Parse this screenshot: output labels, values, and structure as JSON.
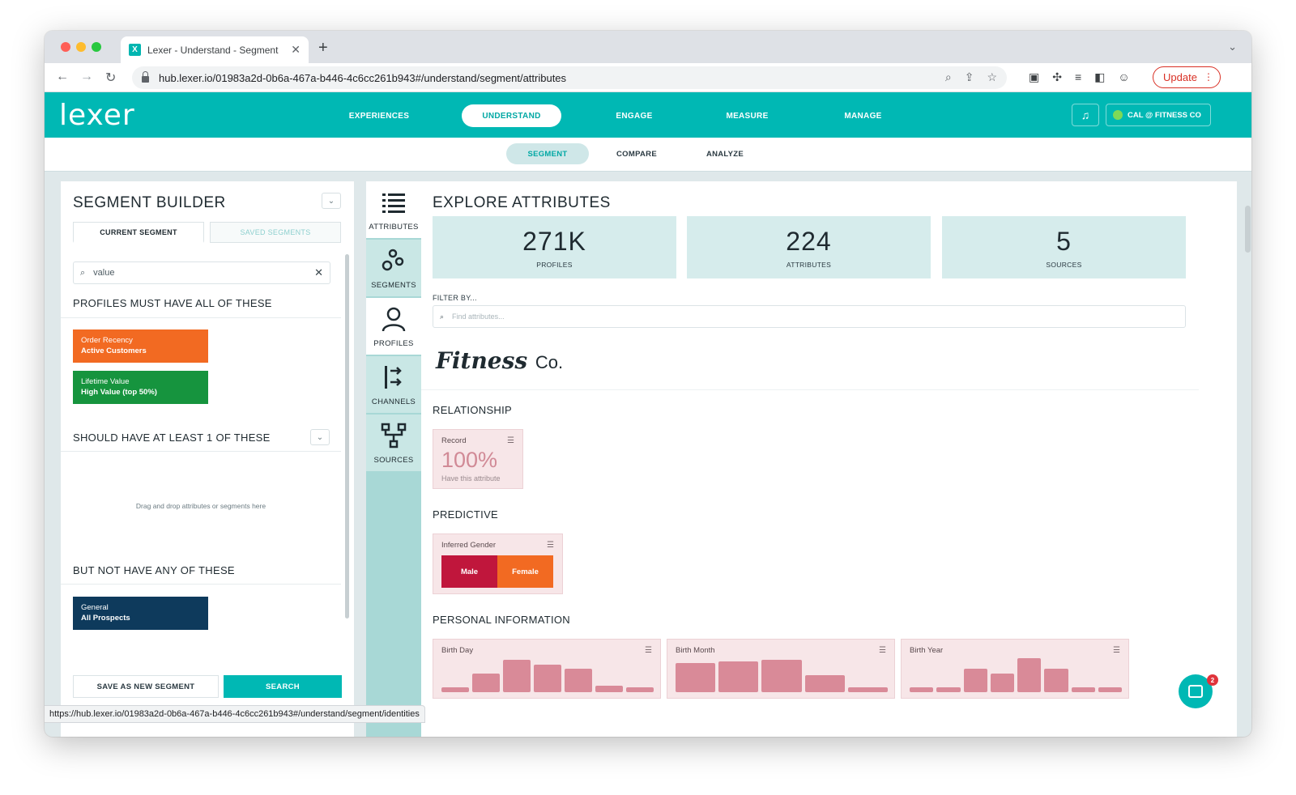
{
  "browser": {
    "tab_title": "Lexer - Understand - Segment",
    "favicon_letter": "X",
    "url": "hub.lexer.io/01983a2d-0b6a-467a-b446-4c6cc261b943#/understand/segment/attributes",
    "update_label": "Update",
    "status_url": "https://hub.lexer.io/01983a2d-0b6a-467a-b446-4c6cc261b943#/understand/segment/identities"
  },
  "app": {
    "logo": "lexer",
    "main_nav": [
      "EXPERIENCES",
      "UNDERSTAND",
      "ENGAGE",
      "MEASURE",
      "MANAGE"
    ],
    "active_main_nav": "UNDERSTAND",
    "account": "CAL @ FITNESS CO",
    "sub_nav": [
      "SEGMENT",
      "COMPARE",
      "ANALYZE"
    ],
    "active_sub_nav": "SEGMENT"
  },
  "builder": {
    "title": "SEGMENT BUILDER",
    "tabs": [
      "CURRENT SEGMENT",
      "SAVED SEGMENTS"
    ],
    "search_value": "value",
    "must_label": "PROFILES MUST HAVE ALL OF THESE",
    "must_chips": [
      {
        "title": "Order Recency",
        "value": "Active Customers",
        "color": "#f26a22"
      },
      {
        "title": "Lifetime Value",
        "value": "High Value (top 50%)",
        "color": "#16943e"
      }
    ],
    "should_label": "SHOULD HAVE AT LEAST 1 OF THESE",
    "drop_hint": "Drag and drop attributes or segments here",
    "not_label": "BUT NOT HAVE ANY OF THESE",
    "not_chips": [
      {
        "title": "General",
        "value": "All Prospects",
        "color": "#0e3a5c"
      }
    ],
    "save_label": "SAVE AS NEW SEGMENT",
    "search_label": "SEARCH"
  },
  "rail": [
    {
      "label": "ATTRIBUTES",
      "icon": "list-icon"
    },
    {
      "label": "SEGMENTS",
      "icon": "circles-icon"
    },
    {
      "label": "PROFILES",
      "icon": "person-icon"
    },
    {
      "label": "CHANNELS",
      "icon": "channels-icon"
    },
    {
      "label": "SOURCES",
      "icon": "hierarchy-icon"
    }
  ],
  "explore": {
    "title": "EXPLORE ATTRIBUTES",
    "stats": [
      {
        "value": "271K",
        "label": "PROFILES"
      },
      {
        "value": "224",
        "label": "ATTRIBUTES"
      },
      {
        "value": "5",
        "label": "SOURCES"
      }
    ],
    "filter_label": "FILTER BY...",
    "filter_placeholder": "Find attributes...",
    "brand": "Fitness",
    "brand_suffix": "Co.",
    "relationship_label": "RELATIONSHIP",
    "record_card": {
      "title": "Record",
      "value": "100%",
      "note": "Have this attribute"
    },
    "predictive_label": "PREDICTIVE",
    "gender_card": {
      "title": "Inferred Gender",
      "male": "Male",
      "female": "Female",
      "male_color": "#c0163c",
      "female_color": "#f26a22",
      "male_share": 0.5
    },
    "personal_label": "PERSONAL INFORMATION",
    "histograms": [
      {
        "title": "Birth Day",
        "values": [
          0.12,
          0.55,
          0.95,
          0.8,
          0.7,
          0.2,
          0.15
        ]
      },
      {
        "title": "Birth Month",
        "values": [
          0.85,
          0.9,
          0.95,
          0.5,
          0.15
        ]
      },
      {
        "title": "Birth Year",
        "values": [
          0.15,
          0.15,
          0.7,
          0.55,
          1.0,
          0.7,
          0.15,
          0.15
        ]
      }
    ]
  },
  "chat_badge": "2"
}
